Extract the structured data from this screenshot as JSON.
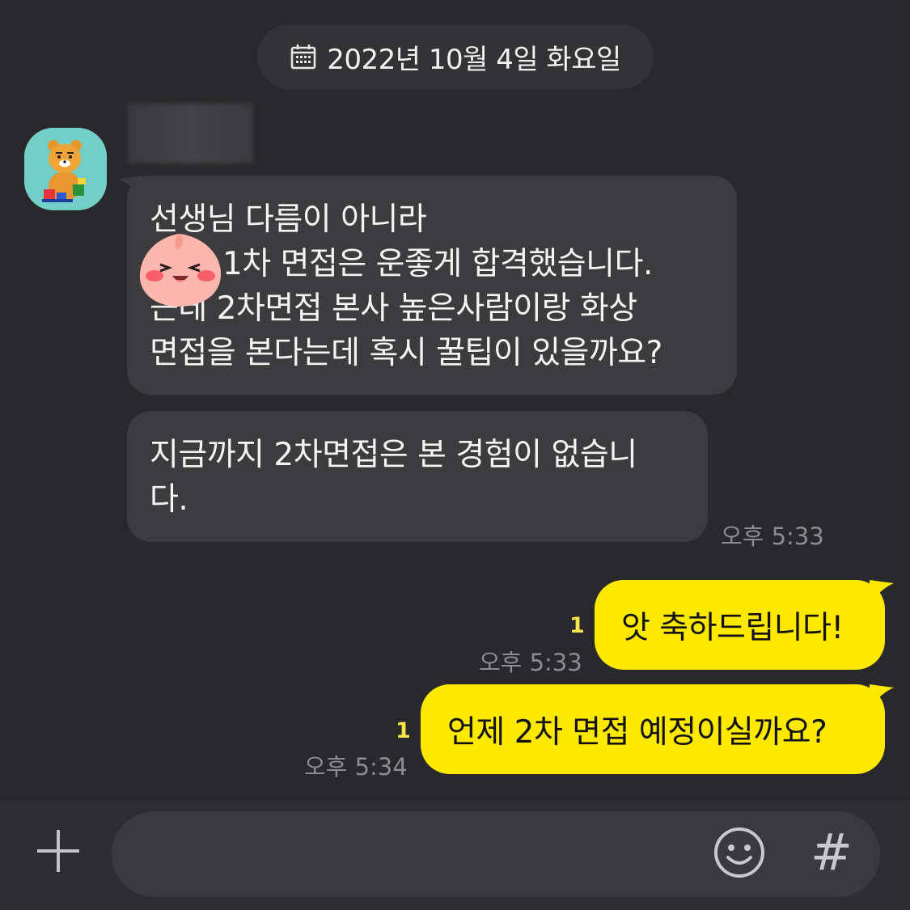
{
  "date_divider": {
    "icon": "calendar-icon",
    "text": "2022년 10월 4일 화요일"
  },
  "incoming": {
    "avatar_icon": "ryan-character-avatar",
    "bubble1_lines": [
      "선생님 다름이 아니라",
      "1차 면접은 운좋게 합격했습니다.",
      "근데 2차면접  본사 높은사람이랑 화상",
      "면접을 본다는데 혹시 꿀팁이 있을까요?"
    ],
    "sticker_icon": "apeach-face-sticker",
    "bubble2_lines": [
      "지금까지 2차면접은 본 경험이 없습니",
      "다."
    ],
    "time": "오후 5:33"
  },
  "outgoing": [
    {
      "text": "앗 축하드립니다!",
      "time": "오후 5:33",
      "unread": "1"
    },
    {
      "text": "언제 2차 면접 예정이실까요?",
      "time": "오후 5:34",
      "unread": "1"
    }
  ],
  "input_bar": {
    "plus_icon": "plus-icon",
    "emoji_icon": "emoji-icon",
    "hash_label": "#"
  },
  "colors": {
    "background": "#29292b",
    "incoming_bubble": "#3c3c3f",
    "outgoing_bubble": "#fde800",
    "unread_count": "#f5e44a"
  }
}
